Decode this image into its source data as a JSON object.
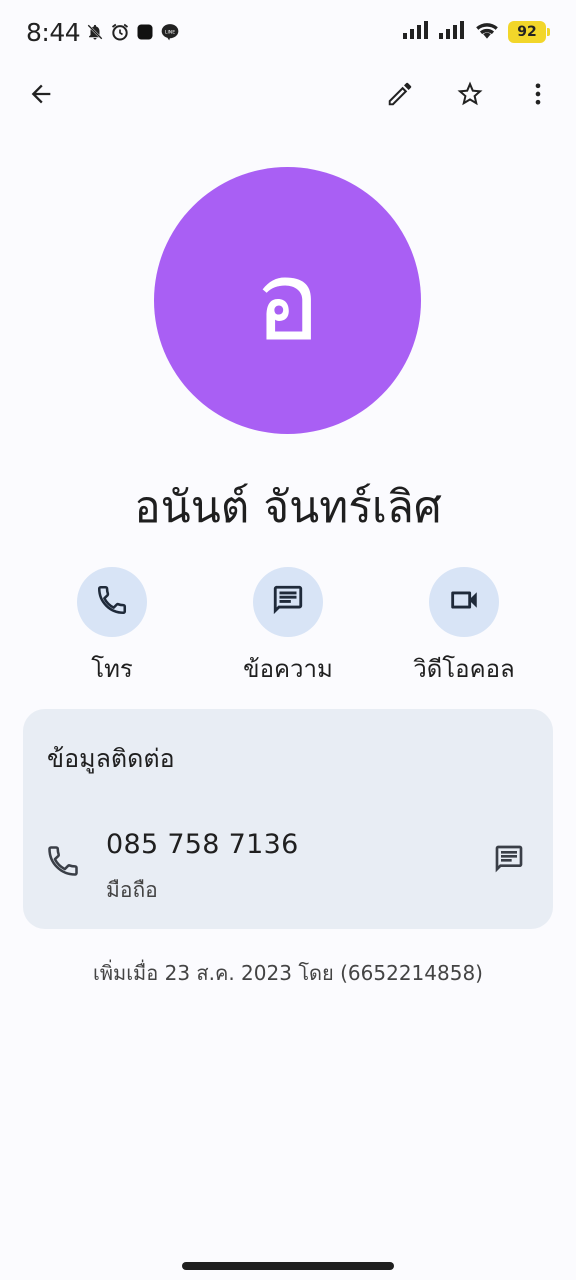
{
  "status_bar": {
    "time": "8:44",
    "battery": "92",
    "icons": [
      "bell-off-icon",
      "alarm-icon",
      "app-icon",
      "line-icon",
      "signal-icon",
      "signal-icon",
      "wifi-icon",
      "battery-icon"
    ]
  },
  "toolbar": {
    "back": "arrow-back-icon",
    "edit": "edit-icon",
    "favorite": "star-icon",
    "more": "more-vert-icon"
  },
  "contact": {
    "avatar_letter": "อ",
    "avatar_color": "#a95ff4",
    "name": "อนันต์ จันทร์เลิศ"
  },
  "actions": {
    "call_label": "โทร",
    "message_label": "ข้อความ",
    "video_label": "วิดีโอคอล"
  },
  "info_card": {
    "title": "ข้อมูลติดต่อ",
    "phone_number": "085 758 7136",
    "phone_type": "มือถือ"
  },
  "footer": {
    "added_text": "เพิ่มเมื่อ 23 ส.ค. 2023 โดย (6652214858)"
  }
}
